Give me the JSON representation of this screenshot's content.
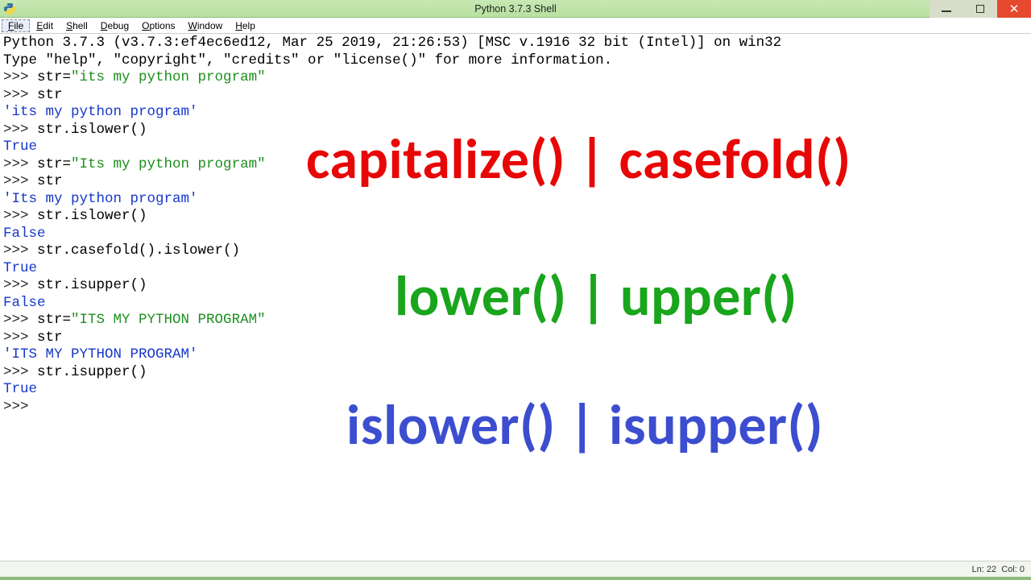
{
  "window": {
    "title": "Python 3.7.3 Shell"
  },
  "menu": {
    "items": [
      {
        "label": "File",
        "mnemonic": "F",
        "selected": true
      },
      {
        "label": "Edit",
        "mnemonic": "E",
        "selected": false
      },
      {
        "label": "Shell",
        "mnemonic": "S",
        "selected": false
      },
      {
        "label": "Debug",
        "mnemonic": "D",
        "selected": false
      },
      {
        "label": "Options",
        "mnemonic": "O",
        "selected": false
      },
      {
        "label": "Window",
        "mnemonic": "W",
        "selected": false
      },
      {
        "label": "Help",
        "mnemonic": "H",
        "selected": false
      }
    ]
  },
  "shell": {
    "banner1": "Python 3.7.3 (v3.7.3:ef4ec6ed12, Mar 25 2019, 21:26:53) [MSC v.1916 32 bit (Intel)] on win32",
    "banner2": "Type \"help\", \"copyright\", \"credits\" or \"license()\" for more information.",
    "lines": [
      {
        "type": "in",
        "code_prefix": "str=",
        "string": "\"its my python program\""
      },
      {
        "type": "in",
        "code_prefix": "str"
      },
      {
        "type": "out",
        "text": "'its my python program'"
      },
      {
        "type": "in",
        "code_prefix": "str.islower()"
      },
      {
        "type": "out",
        "text": "True"
      },
      {
        "type": "in",
        "code_prefix": "str=",
        "string": "\"Its my python program\""
      },
      {
        "type": "in",
        "code_prefix": "str"
      },
      {
        "type": "out",
        "text": "'Its my python program'"
      },
      {
        "type": "in",
        "code_prefix": "str.islower()"
      },
      {
        "type": "out",
        "text": "False"
      },
      {
        "type": "in",
        "code_prefix": "str.casefold().islower()"
      },
      {
        "type": "out",
        "text": "True"
      },
      {
        "type": "in",
        "code_prefix": "str.isupper()"
      },
      {
        "type": "out",
        "text": "False"
      },
      {
        "type": "in",
        "code_prefix": "str=",
        "string": "\"ITS MY PYTHON PROGRAM\""
      },
      {
        "type": "in",
        "code_prefix": "str"
      },
      {
        "type": "out",
        "text": "'ITS MY PYTHON PROGRAM'"
      },
      {
        "type": "in",
        "code_prefix": "str.isupper()"
      },
      {
        "type": "out",
        "text": "True"
      },
      {
        "type": "prompt"
      }
    ],
    "ps1": ">>> "
  },
  "overlays": {
    "red": "capitalize() | casefold()",
    "green": "lower() | upper()",
    "blue": "islower() | isupper()"
  },
  "status": {
    "ln_label": "Ln:",
    "ln": "22",
    "col_label": "Col:",
    "col": "0"
  }
}
